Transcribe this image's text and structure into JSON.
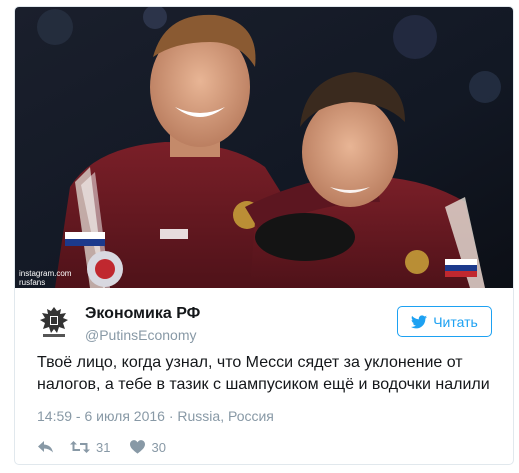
{
  "photo": {
    "watermark_line1": "instagram.com",
    "watermark_line2": "rusfans"
  },
  "author": {
    "name": "Экономика РФ",
    "handle": "@PutinsEconomy"
  },
  "follow_button": {
    "label": "Читать"
  },
  "tweet": {
    "line1": "Твоё лицо, когда узнал, что Месси сядет за уклонение от",
    "line2": "налогов, а тебе в тазик с шампусиком ещё и водочки налили"
  },
  "meta": {
    "time": "14:59 - 6 июля 2016",
    "separator": "·",
    "location": "Russia, Россия"
  },
  "actions": {
    "retweets": "31",
    "likes": "30"
  },
  "colors": {
    "accent": "#1da1f2",
    "muted": "#8899a6",
    "text": "#14171a",
    "jersey": "#6e1a22"
  }
}
